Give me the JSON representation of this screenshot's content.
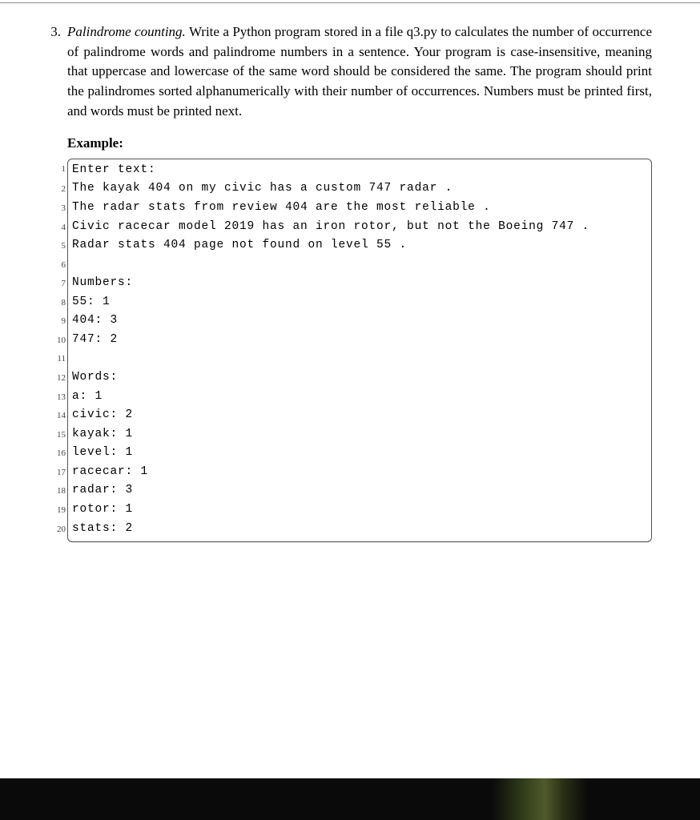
{
  "problem": {
    "number": "3.",
    "title": "Palindrome counting.",
    "description": "Write a Python program stored in a file q3.py to calculates the number of occurrence of palindrome words and palindrome numbers in a sentence. Your program is case-insensitive, meaning that uppercase and lowercase of the same word should be considered the same. The program should print the palindromes sorted alphanumerically with their number of occurrences. Numbers must be printed first, and words must be printed next.",
    "example_label": "Example:"
  },
  "code": {
    "lines": [
      {
        "n": "1",
        "t": "Enter text:"
      },
      {
        "n": "2",
        "t": "The kayak 404 on my civic has a custom 747 radar ."
      },
      {
        "n": "3",
        "t": "The radar stats from review 404 are the most reliable ."
      },
      {
        "n": "4",
        "t": "Civic racecar model 2019 has an iron rotor, but not the Boeing 747 ."
      },
      {
        "n": "5",
        "t": "Radar stats 404 page not found on level 55 ."
      },
      {
        "n": "6",
        "t": " "
      },
      {
        "n": "7",
        "t": "Numbers:"
      },
      {
        "n": "8",
        "t": "55: 1"
      },
      {
        "n": "9",
        "t": "404: 3"
      },
      {
        "n": "10",
        "t": "747: 2"
      },
      {
        "n": "11",
        "t": " "
      },
      {
        "n": "12",
        "t": "Words:"
      },
      {
        "n": "13",
        "t": "a: 1"
      },
      {
        "n": "14",
        "t": "civic: 2"
      },
      {
        "n": "15",
        "t": "kayak: 1"
      },
      {
        "n": "16",
        "t": "level: 1"
      },
      {
        "n": "17",
        "t": "racecar: 1"
      },
      {
        "n": "18",
        "t": "radar: 3"
      },
      {
        "n": "19",
        "t": "rotor: 1"
      },
      {
        "n": "20",
        "t": "stats: 2"
      }
    ]
  }
}
